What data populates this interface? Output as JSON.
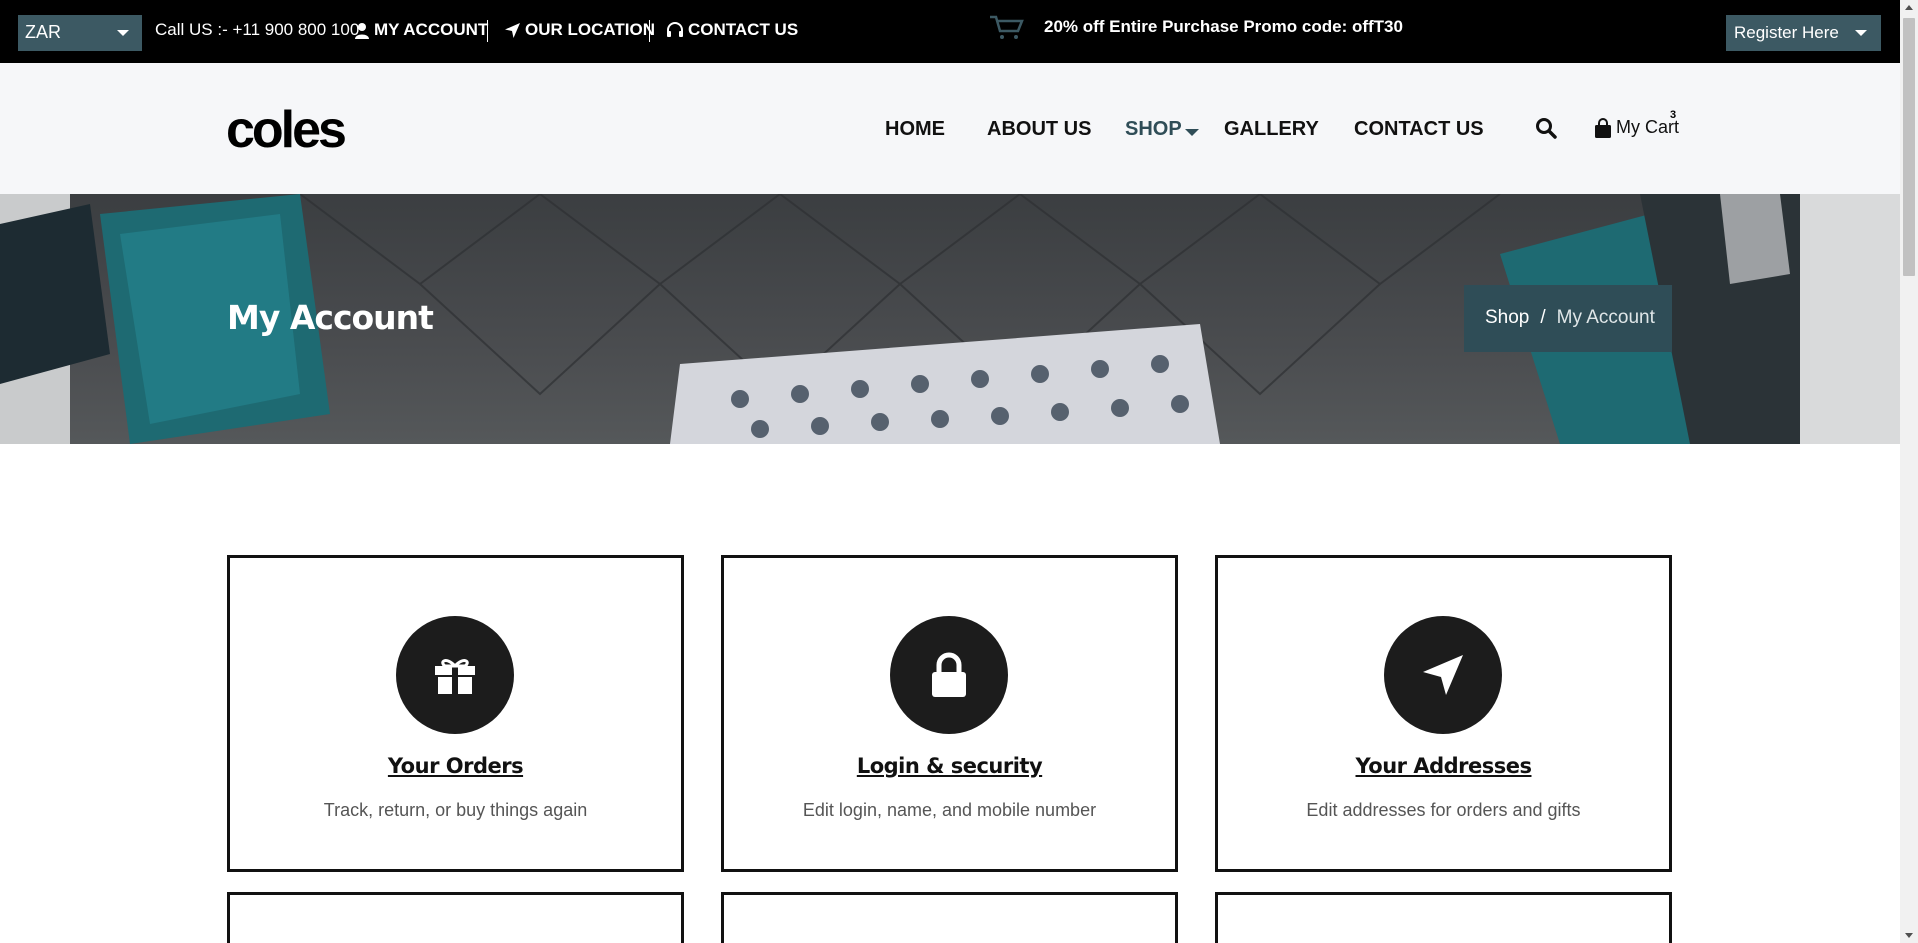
{
  "topbar": {
    "currency": "ZAR",
    "call_text": "Call US :- +11 900 800 100",
    "my_account": "MY ACCOUNT",
    "our_location": "OUR LOCATION",
    "contact_us": "CONTACT US",
    "promo": "20% off Entire Purchase Promo code: offT30",
    "register": "Register Here"
  },
  "header": {
    "logo": "coles",
    "nav": [
      "HOME",
      "ABOUT US",
      "SHOP",
      "GALLERY",
      "CONTACT US"
    ],
    "active_nav": "SHOP",
    "cart_label": "My Cart",
    "cart_count": "3"
  },
  "hero": {
    "title": "My Account",
    "breadcrumb": [
      "Shop",
      "My Account"
    ],
    "breadcrumb_separator": "/"
  },
  "cards": [
    {
      "icon": "gift-icon",
      "title": "Your Orders",
      "description": "Track, return, or buy things again"
    },
    {
      "icon": "lock-icon",
      "title": "Login & security",
      "description": "Edit login, name, and mobile number"
    },
    {
      "icon": "location-arrow-icon",
      "title": "Your Addresses",
      "description": "Edit addresses for orders and gifts"
    }
  ],
  "colors": {
    "accent": "#2f4d57",
    "topbar_bg": "#000000",
    "icon_circle": "#1c1c1c"
  }
}
